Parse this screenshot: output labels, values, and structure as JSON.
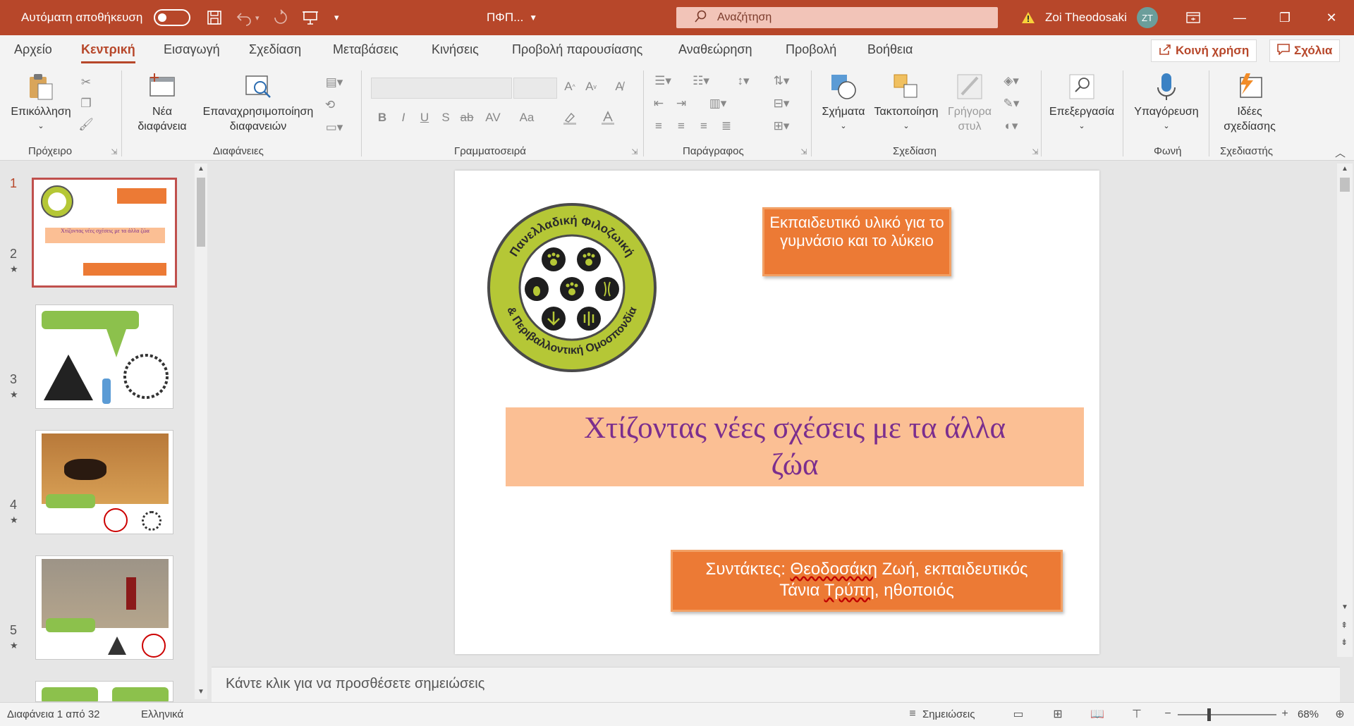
{
  "titlebar": {
    "autosave_label": "Αυτόματη αποθήκευση",
    "filename": "ΠΦΠ...",
    "search_placeholder": "Αναζήτηση",
    "user_name": "Zoi Theodosaki",
    "user_initials": "ZT"
  },
  "menu": {
    "tabs": [
      "Αρχείο",
      "Κεντρική",
      "Εισαγωγή",
      "Σχεδίαση",
      "Μεταβάσεις",
      "Κινήσεις",
      "Προβολή παρουσίασης",
      "Αναθεώρηση",
      "Προβολή",
      "Βοήθεια"
    ],
    "active_tab": "Κεντρική",
    "share_label": "Κοινή χρήση",
    "comments_label": "Σχόλια"
  },
  "ribbon": {
    "paste_label": "Επικόλληση",
    "new_slide_label": "Νέα διαφάνεια",
    "reuse_slides_label_1": "Επαναχρησιμοποίηση",
    "reuse_slides_label_2": "διαφανειών",
    "shapes_label": "Σχήματα",
    "arrange_label": "Τακτοποίηση",
    "quick_styles_label_1": "Γρήγορα",
    "quick_styles_label_2": "στυλ",
    "editing_label": "Επεξεργασία",
    "dictate_label": "Υπαγόρευση",
    "design_ideas_label_1": "Ιδέες",
    "design_ideas_label_2": "σχεδίασης",
    "groups": {
      "clipboard": "Πρόχειρο",
      "slides": "Διαφάνειες",
      "font": "Γραμματοσειρά",
      "paragraph": "Παράγραφος",
      "drawing": "Σχεδίαση",
      "voice": "Φωνή",
      "designer": "Σχεδιαστής"
    },
    "font_buttons": {
      "bold": "B",
      "italic": "I",
      "underline": "U",
      "shadow": "S",
      "strike": "ab",
      "spacing": "AV",
      "case": "Aa"
    }
  },
  "thumbnails": [
    {
      "number": "1",
      "starred": false
    },
    {
      "number": "2",
      "starred": true
    },
    {
      "number": "3",
      "starred": true
    },
    {
      "number": "4",
      "starred": true
    },
    {
      "number": "5",
      "starred": true
    }
  ],
  "thumb_texts": {
    "t1_title": "Χτίζοντας νέες σχέσεις με τα άλλα ζώα"
  },
  "slide": {
    "logo_top_text": "Πανελλαδική Φιλοζωική",
    "logo_bottom_text": "& Περιβαλλοντική Ομοσπονδία",
    "top_box_text": "Εκπαιδευτικό υλικό για το γυμνάσιο και το λύκειο",
    "title_line1": "Χτίζοντας νέες σχέσεις με τα άλλα",
    "title_line2": "ζώα",
    "authors_line1_prefix": "Συντάκτες: ",
    "authors_line1_name1": "Θεοδοσάκη",
    "authors_line1_rest": " Ζωή, εκπαιδευτικός",
    "authors_line2_first": "Τάνια ",
    "authors_line2_name2": "Τρύπη",
    "authors_line2_rest": ", ηθοποιός"
  },
  "notes_placeholder": "Κάντε κλικ για να προσθέσετε σημειώσεις",
  "status": {
    "slide_counter": "Διαφάνεια 1 από 32",
    "language": "Ελληνικά",
    "notes_label": "Σημειώσεις",
    "zoom": "68%"
  },
  "colors": {
    "accent": "#b7472a",
    "orange_box": "#ec7a35",
    "title_bg": "#fbbf94",
    "title_text": "#7b2e8e",
    "logo_green": "#b5c736"
  }
}
